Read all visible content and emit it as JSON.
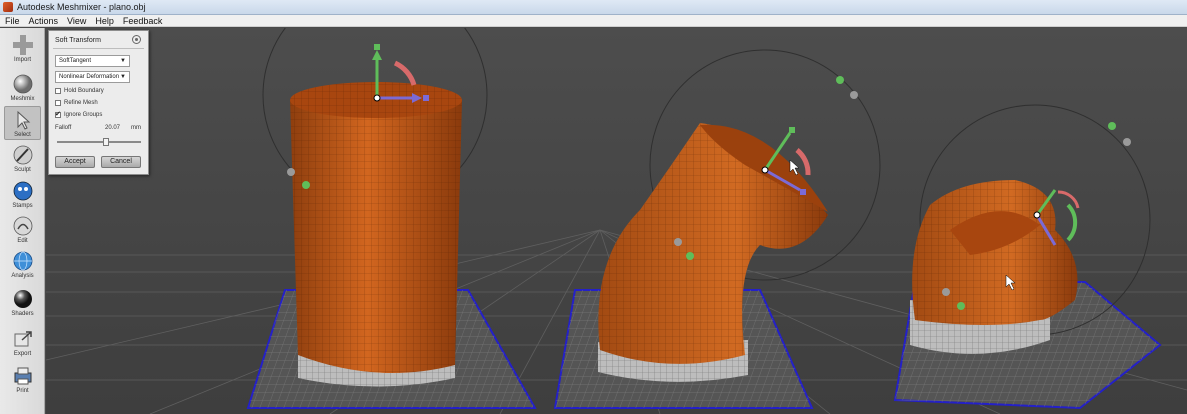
{
  "window": {
    "title": "Autodesk Meshmixer - plano.obj"
  },
  "menu": [
    "File",
    "Actions",
    "View",
    "Help",
    "Feedback"
  ],
  "toolbar": {
    "items": [
      {
        "label": "Import",
        "icon": "plus-icon"
      },
      {
        "label": "Meshmix",
        "icon": "meshmix-sphere-icon"
      },
      {
        "label": "Select",
        "icon": "cursor-arrow-icon"
      },
      {
        "label": "Sculpt",
        "icon": "brush-icon"
      },
      {
        "label": "Stamps",
        "icon": "stamps-icon"
      },
      {
        "label": "Edit",
        "icon": "edit-icon"
      },
      {
        "label": "Analysis",
        "icon": "analysis-globe-icon"
      },
      {
        "label": "Shaders",
        "icon": "shader-ball-icon"
      },
      {
        "label": "Export",
        "icon": "export-arrow-icon"
      },
      {
        "label": "Print",
        "icon": "printer-icon"
      }
    ],
    "active": "Select"
  },
  "panel": {
    "title": "Soft Transform",
    "mode_select": "SoftTangent",
    "deform_select": "Nonlinear Deformation",
    "checkboxes": [
      {
        "label": "Hold Boundary",
        "checked": false
      },
      {
        "label": "Refine Mesh",
        "checked": false
      },
      {
        "label": "Ignore Groups",
        "checked": true
      }
    ],
    "falloff_label": "Falloff",
    "falloff_value": "20.07",
    "falloff_unit": "mm",
    "falloff_slider_fraction": 0.58,
    "accept_label": "Accept",
    "cancel_label": "Cancel"
  },
  "colors": {
    "mesh": "#c45a18",
    "base": "#bdbdbd",
    "grid": "#5f5f5f",
    "plate_border": "#2420c8",
    "gizmo_green": "#5fbd5a",
    "gizmo_red": "#d86a6a",
    "gizmo_blue": "#7b6ad6",
    "toolbar_accent": "#c2c2c2"
  }
}
